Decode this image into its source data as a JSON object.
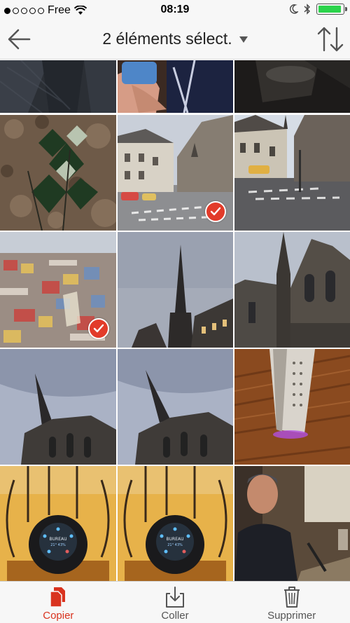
{
  "status_bar": {
    "carrier": "Free",
    "time": "08:19",
    "signal_dots": [
      true,
      false,
      false,
      false,
      false
    ],
    "battery_level": 0.95,
    "battery_color": "#2bd34b"
  },
  "nav": {
    "title": "2 éléments sélect.",
    "back_icon": "arrow-left-icon",
    "sort_icon": "sort-arrows-icon"
  },
  "grid": {
    "columns": 3,
    "photos": [
      {
        "subject": "dark jeans fabric",
        "selected": false
      },
      {
        "subject": "hand holding phone",
        "selected": false
      },
      {
        "subject": "dark interior",
        "selected": false
      },
      {
        "subject": "ivy on ground",
        "selected": false
      },
      {
        "subject": "street with buildings and car",
        "selected": true
      },
      {
        "subject": "town square with church",
        "selected": false
      },
      {
        "subject": "shop window display",
        "selected": true
      },
      {
        "subject": "church spire against sky",
        "selected": false
      },
      {
        "subject": "gothic church",
        "selected": false
      },
      {
        "subject": "gothic church from below",
        "selected": false
      },
      {
        "subject": "gothic church from below",
        "selected": false
      },
      {
        "subject": "speaker on wooden table",
        "selected": false
      },
      {
        "subject": "thermostat display",
        "selected": false
      },
      {
        "subject": "thermostat display",
        "selected": false
      },
      {
        "subject": "man in dark sweater",
        "selected": false
      }
    ],
    "thermostat_text": {
      "line1": "BUREAU",
      "line2": "21°  43%"
    }
  },
  "toolbar": {
    "tabs": [
      {
        "label": "Copier",
        "icon": "copy-documents-icon",
        "active": true
      },
      {
        "label": "Coller",
        "icon": "paste-download-icon",
        "active": false
      },
      {
        "label": "Supprimer",
        "icon": "trash-icon",
        "active": false
      }
    ],
    "accent_color": "#d9331f"
  }
}
